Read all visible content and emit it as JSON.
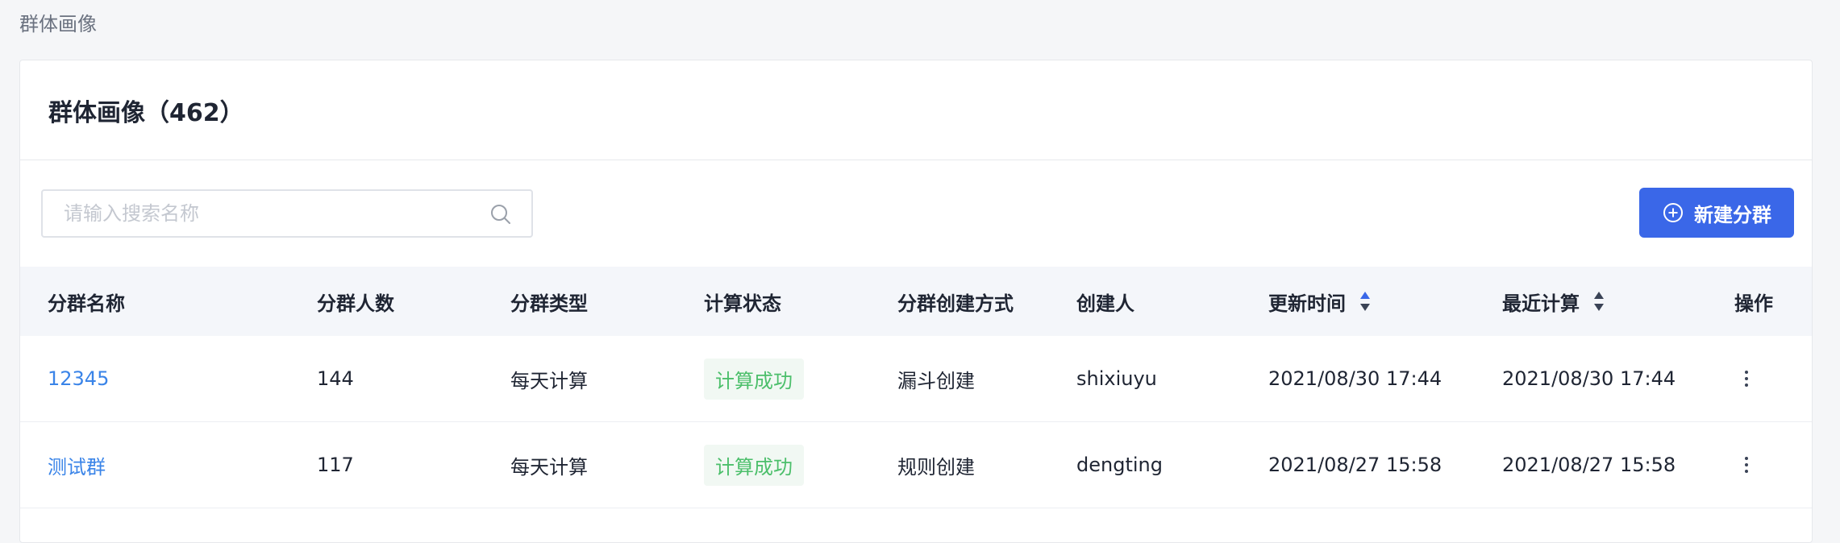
{
  "breadcrumb": "群体画像",
  "card": {
    "title": "群体画像（462）"
  },
  "search": {
    "placeholder": "请输入搜索名称",
    "value": ""
  },
  "new_button": {
    "label": "新建分群"
  },
  "table": {
    "columns": [
      "分群名称",
      "分群人数",
      "分群类型",
      "计算状态",
      "分群创建方式",
      "创建人",
      "更新时间",
      "最近计算",
      "操作"
    ],
    "rows": [
      {
        "name": "12345",
        "count": "144",
        "type": "每天计算",
        "status": "计算成功",
        "method": "漏斗创建",
        "creator": "shixiuyu",
        "updated": "2021/08/30 17:44",
        "last_calc": "2021/08/30 17:44"
      },
      {
        "name": "测试群",
        "count": "117",
        "type": "每天计算",
        "status": "计算成功",
        "method": "规则创建",
        "creator": "dengting",
        "updated": "2021/08/27 15:58",
        "last_calc": "2021/08/27 15:58"
      }
    ]
  },
  "colors": {
    "accent": "#3a67e8",
    "link": "#3a84e8",
    "success": "#4cbf6b"
  },
  "icons": {
    "search": "search-icon",
    "add": "plus-circle-icon",
    "sort": "sort-icon",
    "more": "more-vertical-icon"
  }
}
